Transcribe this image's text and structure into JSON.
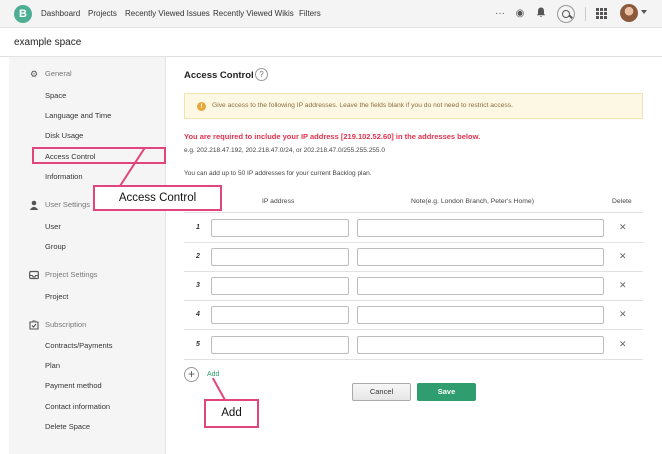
{
  "topnav": {
    "logo": "B",
    "links": [
      "Dashboard",
      "Projects",
      "Recently Viewed Issues",
      "Recently Viewed Wikis",
      "Filters"
    ],
    "icons": [
      "more-icon",
      "watch-icon",
      "notification-icon",
      "search-icon",
      "apps-grid-icon",
      "avatar",
      "chevron-down-icon"
    ]
  },
  "space": {
    "name": "example space"
  },
  "sidebar": {
    "sections": [
      {
        "title": "General",
        "icon": "gear-icon",
        "items": [
          "Space",
          "Language and Time",
          "Disk Usage",
          "Access Control",
          "Information"
        ]
      },
      {
        "title": "User Settings",
        "icon": "user-icon",
        "items": [
          "User",
          "Group"
        ]
      },
      {
        "title": "Project Settings",
        "icon": "inbox-icon",
        "items": [
          "Project"
        ]
      },
      {
        "title": "Subscription",
        "icon": "subscription-icon",
        "items": [
          "Contracts/Payments",
          "Plan",
          "Payment method",
          "Contact information",
          "Delete Space"
        ]
      }
    ],
    "selected": "Access Control"
  },
  "main": {
    "title": "Access Control",
    "help": "?",
    "notice": "Give access to the following IP addresses. Leave the fields blank if you do not need to restrict access.",
    "notice_icon": "!",
    "required": "You are required to include your IP address [219.102.52.60] in the addresses below.",
    "example": "e.g. 202.218.47.192, 202.218.47.0/24, or 202.218.47.0/255.255.255.0",
    "limit": "You can add up to 50 IP addresses for your current Backlog plan.",
    "table": {
      "headers": {
        "ip": "IP address",
        "note": "Note(e.g. London Branch, Peter's Home)",
        "delete": "Delete"
      },
      "rows": [
        {
          "num": "1",
          "ip": "",
          "note": "",
          "delete": "✕"
        },
        {
          "num": "2",
          "ip": "",
          "note": "",
          "delete": "✕"
        },
        {
          "num": "3",
          "ip": "",
          "note": "",
          "delete": "✕"
        },
        {
          "num": "4",
          "ip": "",
          "note": "",
          "delete": "✕"
        },
        {
          "num": "5",
          "ip": "",
          "note": "",
          "delete": "✕"
        }
      ]
    },
    "add_label": "Add",
    "cancel_label": "Cancel",
    "save_label": "Save"
  },
  "annotations": {
    "callout_access": "Access Control",
    "callout_add": "Add",
    "color": "#e0457d"
  },
  "colors": {
    "accent": "#2f9d6e",
    "alert": "#e2314d",
    "highlight": "#e0457d"
  }
}
